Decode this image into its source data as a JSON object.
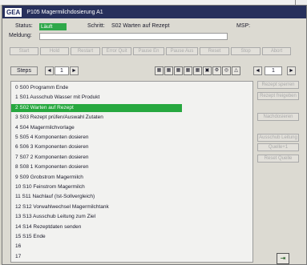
{
  "window": {
    "logo": "GEA",
    "title": "P105 Magermilchdosierung A1"
  },
  "status": {
    "status_label": "Status:",
    "status_value": "Läuft",
    "schritt_label": "Schritt:",
    "schritt_value": "S02 Warten auf Rezept",
    "msp_label": "MSP:",
    "meldung_label": "Meldung:"
  },
  "toolbar": [
    "Start",
    "Hold",
    "Restart",
    "Error Quit",
    "Pause En",
    "Pause Aus",
    "Reset",
    "Stop",
    "Abort"
  ],
  "steps_bar": {
    "label": "Steps",
    "left_page": "1",
    "right_page": "1",
    "left_arrow": "◄",
    "right_arrow": "►"
  },
  "icons": [
    "grid-icon",
    "grid-icon",
    "grid-icon",
    "grid-icon",
    "grid-icon",
    "monitor-icon",
    "tools-icon",
    "info-icon",
    "warning-icon"
  ],
  "steps": [
    "0   S00 Programm Ende",
    "1   S01 Ausschub Wasser mit Produkt",
    "2   S02 Warten auf Rezept",
    "3   S03 Rezept prüfen/Auswahl Zutaten",
    "4   S04 Magermilchvorlage",
    "5   S05 4 Komponenten dosieren",
    "6   S06 3 Komponenten dosieren",
    "7   S07 2 Komponenten dosieren",
    "8   S08 1 Komponenten dosieren",
    "9   S09 Grobstrom Magermilch",
    "10  S10 Feinstrom Magermilch",
    "11  S11 Nachlauf (Ist-Sollvergleich)",
    "12  S12 Vorwahlwechsel Magermilchtank",
    "13  S13 Ausschub Leitung zum Ziel",
    "14  S14 Rezeptdaten senden",
    "15  S15 Ende",
    "16",
    "17"
  ],
  "selected_index": 2,
  "side_buttons": [
    "Rezept sperren",
    "Rezept freigeben",
    "Nachdosieren",
    "Ausschub Leitung",
    "Quelle+1",
    "Reset Quelle"
  ]
}
